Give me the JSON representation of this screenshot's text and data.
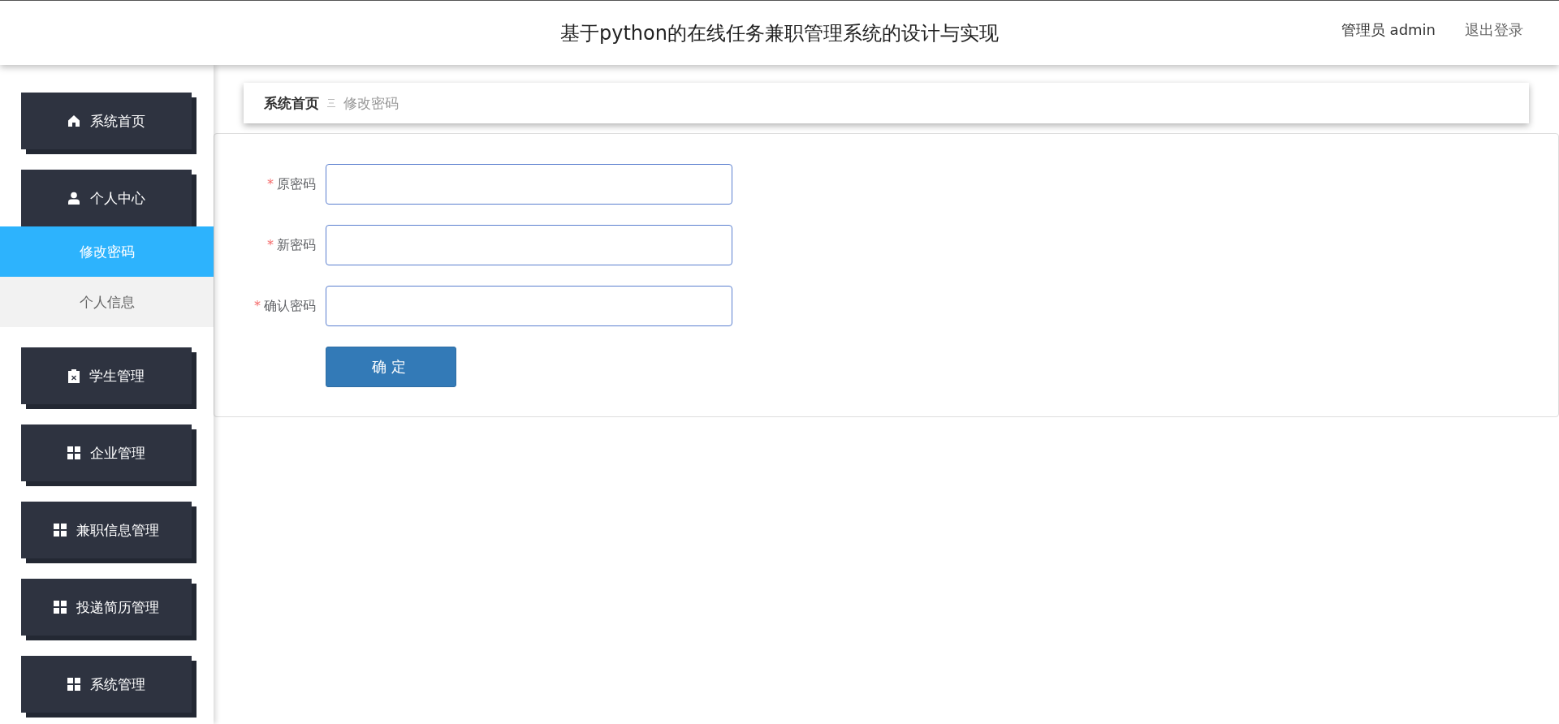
{
  "header": {
    "title": "基于python的在线任务兼职管理系统的设计与实现",
    "user": "管理员 admin",
    "logout": "退出登录"
  },
  "sidebar": {
    "items": [
      {
        "label": "系统首页"
      },
      {
        "label": "个人中心",
        "children": [
          {
            "label": "修改密码",
            "selected": true
          },
          {
            "label": "个人信息",
            "selected": false
          }
        ]
      },
      {
        "label": "学生管理"
      },
      {
        "label": "企业管理"
      },
      {
        "label": "兼职信息管理"
      },
      {
        "label": "投递简历管理"
      },
      {
        "label": "系统管理"
      }
    ]
  },
  "breadcrumb": {
    "items": [
      "系统首页",
      "修改密码"
    ]
  },
  "form": {
    "fields": [
      {
        "label": "原密码",
        "required_mark": "*"
      },
      {
        "label": "新密码",
        "required_mark": "*"
      },
      {
        "label": "确认密码",
        "required_mark": "*"
      }
    ],
    "submit": "确定"
  }
}
